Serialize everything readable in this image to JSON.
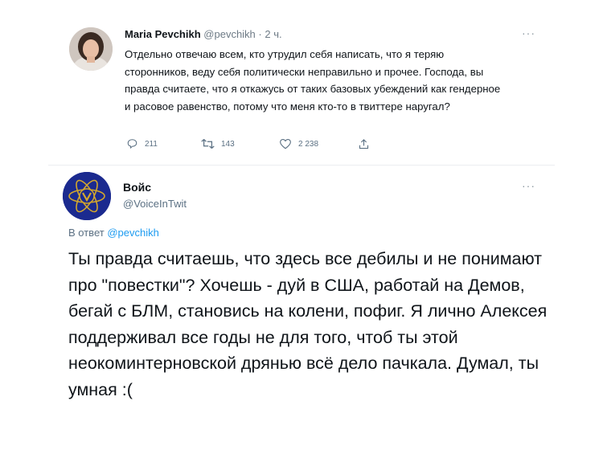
{
  "tweet1": {
    "author_name": "Maria Pevchikh",
    "author_handle": "@pevchikh",
    "time": "· 2 ч.",
    "more": "···",
    "text": "Отдельно отвечаю всем, кто утрудил себя написать, что я теряю сторонников, веду себя политически неправильно и прочее. Господа, вы правда считаете, что я откажусь от таких базовых убеждений как гендерное и расовое равенство, потому что меня кто-то в твиттере наругал?",
    "actions": {
      "replies": "211",
      "retweets": "143",
      "likes": "2 238"
    }
  },
  "tweet2": {
    "author_name": "Войс",
    "author_handle": "@VoiceInTwit",
    "more": "···",
    "reply_prefix": "В ответ",
    "reply_to": "@pevchikh",
    "text": "Ты правда считаешь, что здесь все дебилы и не понимают про \"повестки\"? Хочешь - дуй в США, работай на Демов, бегай с БЛМ, становись на колени, пофиг. Я лично Алексея поддерживал все годы не для того, чтоб ты этой неокоминтерновской дрянью всё дело пачкала. Думал, ты умная :("
  },
  "colors": {
    "accent": "#1d9bf0",
    "secondary_text": "#5b7083",
    "voice_avatar_bg": "#1b2a8f",
    "voice_avatar_gold": "#d4a72c"
  }
}
